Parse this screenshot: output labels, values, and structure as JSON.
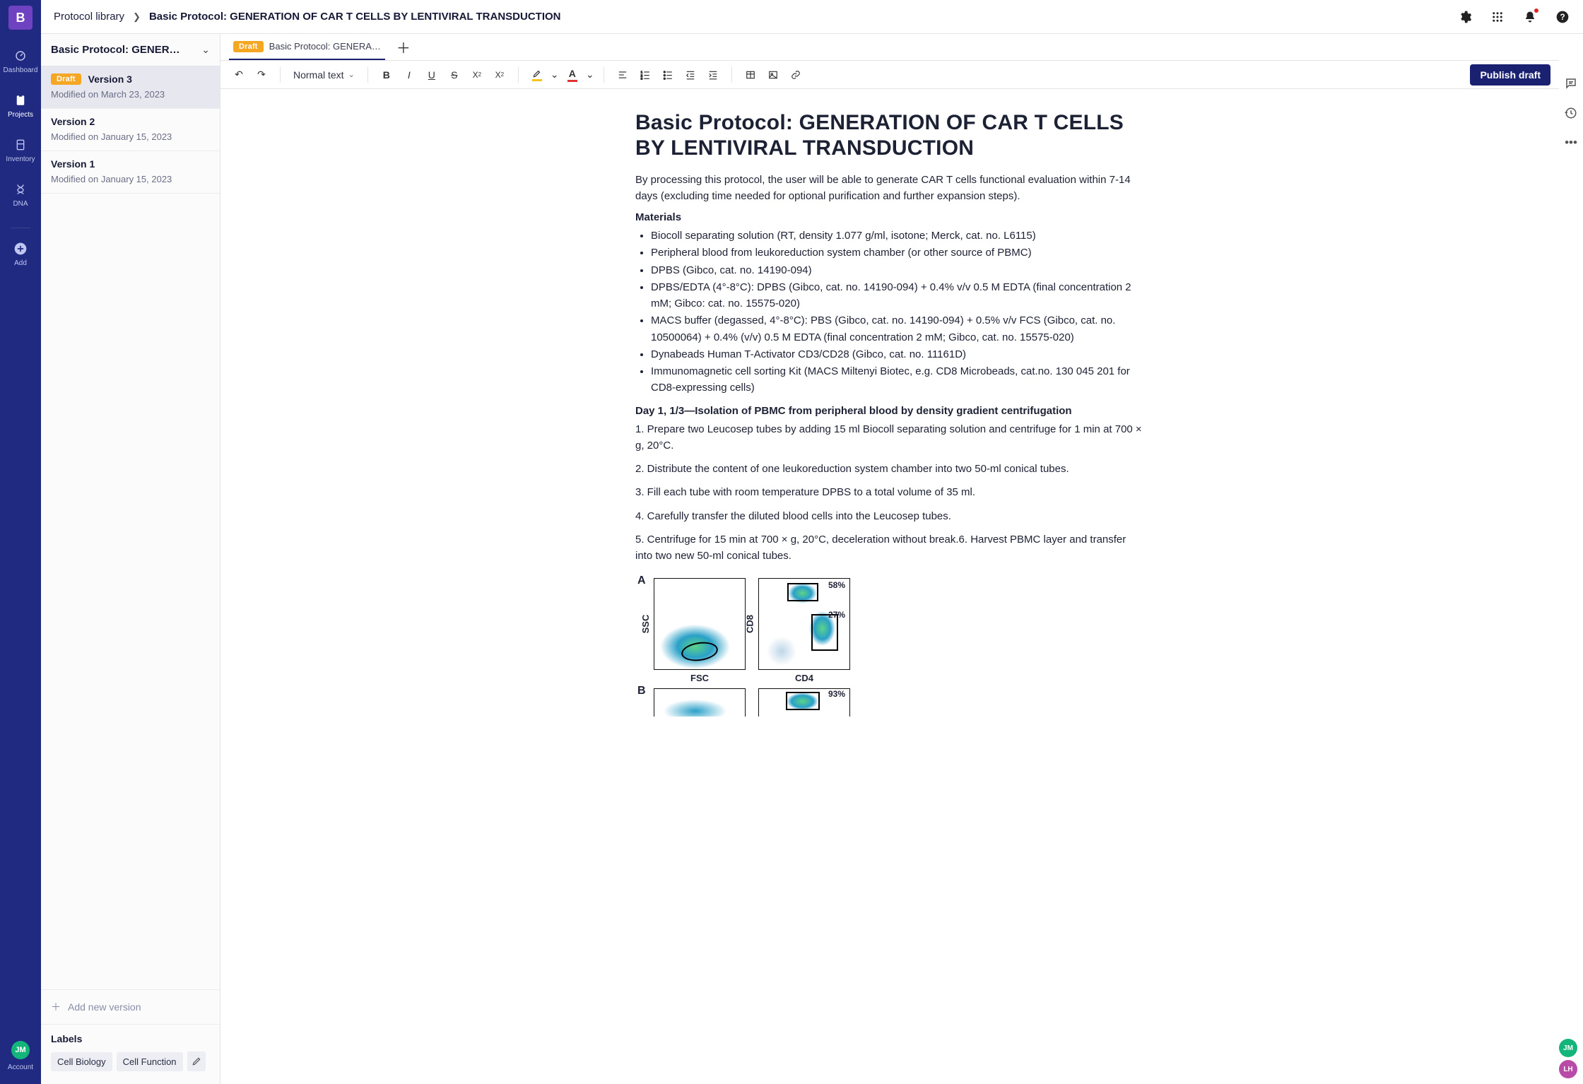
{
  "rail": {
    "logo": "B",
    "items": [
      {
        "icon": "dashboard",
        "label": "Dashboard"
      },
      {
        "icon": "projects",
        "label": "Projects"
      },
      {
        "icon": "inventory",
        "label": "Inventory"
      },
      {
        "icon": "dna",
        "label": "DNA"
      },
      {
        "icon": "add",
        "label": "Add"
      }
    ],
    "account": {
      "initials": "JM",
      "label": "Account"
    }
  },
  "breadcrumb": {
    "root": "Protocol library",
    "current": "Basic Protocol: GENERATION OF CAR T CELLS BY LENTIVIRAL TRANSDUCTION"
  },
  "versions_panel": {
    "title": "Basic Protocol: GENERATION…",
    "versions": [
      {
        "badge": "Draft",
        "title": "Version 3",
        "sub": "Modified on March 23, 2023",
        "active": true
      },
      {
        "badge": null,
        "title": "Version 2",
        "sub": "Modified on January 15, 2023",
        "active": false
      },
      {
        "badge": null,
        "title": "Version 1",
        "sub": "Modified on January 15, 2023",
        "active": false
      }
    ],
    "add_label": "Add new version",
    "labels_heading": "Labels",
    "labels": [
      "Cell Biology",
      "Cell Function"
    ]
  },
  "tab": {
    "badge": "Draft",
    "label": "Basic Protocol: GENERA…"
  },
  "toolbar": {
    "text_style": "Normal text",
    "publish": "Publish draft"
  },
  "document": {
    "title": "Basic Protocol: GENERATION OF CAR T CELLS BY LENTIVIRAL TRANSDUCTION",
    "intro": "By processing this protocol, the user will be able to generate CAR T cells functional evaluation within 7-14 days (excluding time needed for optional purification and further expansion steps).",
    "materials_heading": "Materials",
    "materials": [
      "Biocoll separating solution (RT, density 1.077 g/ml, isotone; Merck, cat. no. L6115)",
      "Peripheral blood from leukoreduction system chamber (or other source of PBMC)",
      "DPBS (Gibco, cat. no. 14190-094)",
      "DPBS/EDTA (4°-8°C): DPBS (Gibco, cat. no. 14190-094) + 0.4% v/v 0.5 M EDTA (final concentration 2 mM; Gibco: cat. no. 15575-020)",
      "MACS buffer (degassed, 4°-8°C): PBS (Gibco, cat. no. 14190-094) + 0.5% v/v FCS (Gibco, cat. no. 10500064) + 0.4% (v/v) 0.5 M EDTA (final concentration 2 mM; Gibco, cat. no. 15575-020)",
      "Dynabeads Human T-Activator CD3/CD28 (Gibco, cat. no. 11161D)",
      "Immunomagnetic cell sorting Kit (MACS Miltenyi Biotec, e.g. CD8 Microbeads, cat.no. 130 045 201 for CD8-expressing cells)"
    ],
    "day1_heading": "Day 1, 1/3—Isolation of PBMC from peripheral blood by density gradient centrifugation",
    "steps": [
      "1. Prepare two Leucosep tubes by adding 15 ml Biocoll separating solution and centrifuge for 1 min at 700 × g, 20°C.",
      "2. Distribute the content of one leukoreduction system chamber into two 50-ml conical tubes.",
      "3. Fill each tube with room temperature DPBS to a total volume of 35 ml.",
      "4. Carefully transfer the diluted blood cells into the Leucosep tubes.",
      "5. Centrifuge for 15 min at 700 × g, 20°C, deceleration without break.6. Harvest PBMC layer and transfer into two new 50-ml conical tubes."
    ]
  },
  "figure": {
    "panel_a": {
      "left": {
        "x_label": "FSC",
        "y_label": "SSC"
      },
      "right": {
        "x_label": "CD4",
        "y_label": "CD8",
        "pct_top": "58%",
        "pct_bottom": "27%"
      }
    },
    "panel_b": {
      "pct": "93%"
    }
  },
  "chart_data": [
    {
      "type": "scatter",
      "title": "Panel A left — FSC vs SSC with lymphocyte gate",
      "xlabel": "FSC",
      "ylabel": "SSC",
      "annotations": [
        "oval gate"
      ]
    },
    {
      "type": "scatter",
      "title": "Panel A right — CD4 vs CD8",
      "xlabel": "CD4",
      "ylabel": "CD8",
      "gates": [
        {
          "name": "CD8+",
          "percent": 58
        },
        {
          "name": "CD4+",
          "percent": 27
        }
      ]
    },
    {
      "type": "scatter",
      "title": "Panel B right",
      "gates": [
        {
          "percent": 93
        }
      ]
    }
  ],
  "presence": [
    {
      "initials": "JM",
      "class": "jm"
    },
    {
      "initials": "LH",
      "class": "lh"
    }
  ]
}
